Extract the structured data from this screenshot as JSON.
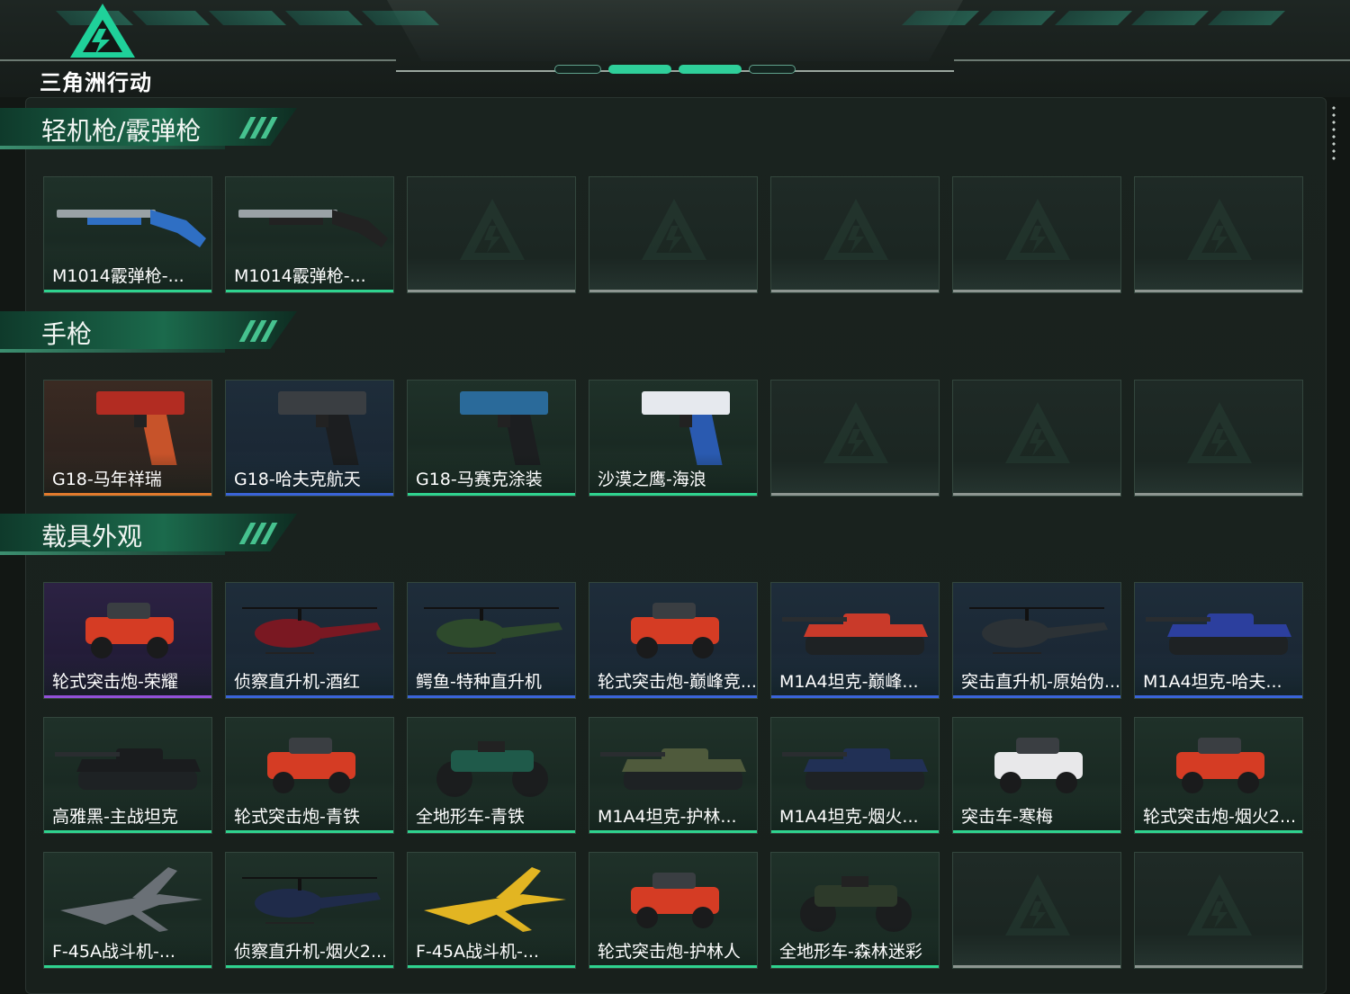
{
  "header": {
    "game_title": "三角洲行动",
    "logo_icon": "delta-triangle-logo-icon"
  },
  "colors": {
    "rarity_green": "#2fd38f",
    "rarity_blue": "#3a64d8",
    "rarity_purple": "#9250d8",
    "rarity_orange": "#e27a2c",
    "empty_gray": "#8d9691"
  },
  "sections": [
    {
      "title": "轻机枪/霰弹枪",
      "items": [
        {
          "name": "M1014霰弹枪-...",
          "rarity": "green",
          "icon": "shotgun-blue-skin-icon"
        },
        {
          "name": "M1014霰弹枪-...",
          "rarity": "green",
          "icon": "shotgun-black-skin-icon"
        },
        {
          "name": "",
          "rarity": "empty",
          "icon": "empty-slot-icon"
        },
        {
          "name": "",
          "rarity": "empty",
          "icon": "empty-slot-icon"
        },
        {
          "name": "",
          "rarity": "empty",
          "icon": "empty-slot-icon"
        },
        {
          "name": "",
          "rarity": "empty",
          "icon": "empty-slot-icon"
        },
        {
          "name": "",
          "rarity": "empty",
          "icon": "empty-slot-icon"
        }
      ]
    },
    {
      "title": "手枪",
      "items": [
        {
          "name": "G18-马年祥瑞",
          "rarity": "orange",
          "icon": "pistol-red-gold-icon"
        },
        {
          "name": "G18-哈夫克航天",
          "rarity": "blue",
          "icon": "pistol-dark-icon"
        },
        {
          "name": "G18-马赛克涂装",
          "rarity": "green",
          "icon": "pistol-mosaic-icon"
        },
        {
          "name": "沙漠之鹰-海浪",
          "rarity": "green",
          "icon": "desert-eagle-wave-icon"
        },
        {
          "name": "",
          "rarity": "empty",
          "icon": "empty-slot-icon"
        },
        {
          "name": "",
          "rarity": "empty",
          "icon": "empty-slot-icon"
        },
        {
          "name": "",
          "rarity": "empty",
          "icon": "empty-slot-icon"
        }
      ]
    },
    {
      "title": "载具外观",
      "items": [
        {
          "name": "轮式突击炮-荣耀",
          "rarity": "purple",
          "icon": "armored-car-icon"
        },
        {
          "name": "侦察直升机-酒红",
          "rarity": "blue",
          "icon": "scout-helicopter-icon"
        },
        {
          "name": "鳄鱼-特种直升机",
          "rarity": "blue",
          "icon": "attack-helicopter-icon"
        },
        {
          "name": "轮式突击炮-巅峰竞...",
          "rarity": "blue",
          "icon": "armored-car-red-icon"
        },
        {
          "name": "M1A4坦克-巅峰...",
          "rarity": "blue",
          "icon": "tank-red-white-icon"
        },
        {
          "name": "突击直升机-原始伪...",
          "rarity": "blue",
          "icon": "attack-helicopter-camo-icon"
        },
        {
          "name": "M1A4坦克-哈夫...",
          "rarity": "blue",
          "icon": "tank-blue-icon"
        },
        {
          "name": "高雅黑-主战坦克",
          "rarity": "green",
          "icon": "tank-black-icon"
        },
        {
          "name": "轮式突击炮-青铁",
          "rarity": "green",
          "icon": "armored-car-teal-icon"
        },
        {
          "name": "全地形车-青铁",
          "rarity": "green",
          "icon": "atv-teal-icon"
        },
        {
          "name": "M1A4坦克-护林...",
          "rarity": "green",
          "icon": "tank-camo-icon"
        },
        {
          "name": "M1A4坦克-烟火...",
          "rarity": "green",
          "icon": "tank-navy-icon"
        },
        {
          "name": "突击车-寒梅",
          "rarity": "green",
          "icon": "assault-vehicle-white-icon"
        },
        {
          "name": "轮式突击炮-烟火2...",
          "rarity": "green",
          "icon": "armored-car-navy-icon"
        },
        {
          "name": "F-45A战斗机-...",
          "rarity": "green",
          "icon": "fighter-jet-camo-icon"
        },
        {
          "name": "侦察直升机-烟火2...",
          "rarity": "green",
          "icon": "scout-helicopter-navy-icon"
        },
        {
          "name": "F-45A战斗机-...",
          "rarity": "green",
          "icon": "fighter-jet-yellow-icon"
        },
        {
          "name": "轮式突击炮-护林人",
          "rarity": "green",
          "icon": "armored-car-camo-icon"
        },
        {
          "name": "全地形车-森林迷彩",
          "rarity": "green",
          "icon": "atv-forest-camo-icon"
        },
        {
          "name": "",
          "rarity": "empty",
          "icon": "empty-slot-icon"
        },
        {
          "name": "",
          "rarity": "empty",
          "icon": "empty-slot-icon"
        }
      ]
    }
  ]
}
